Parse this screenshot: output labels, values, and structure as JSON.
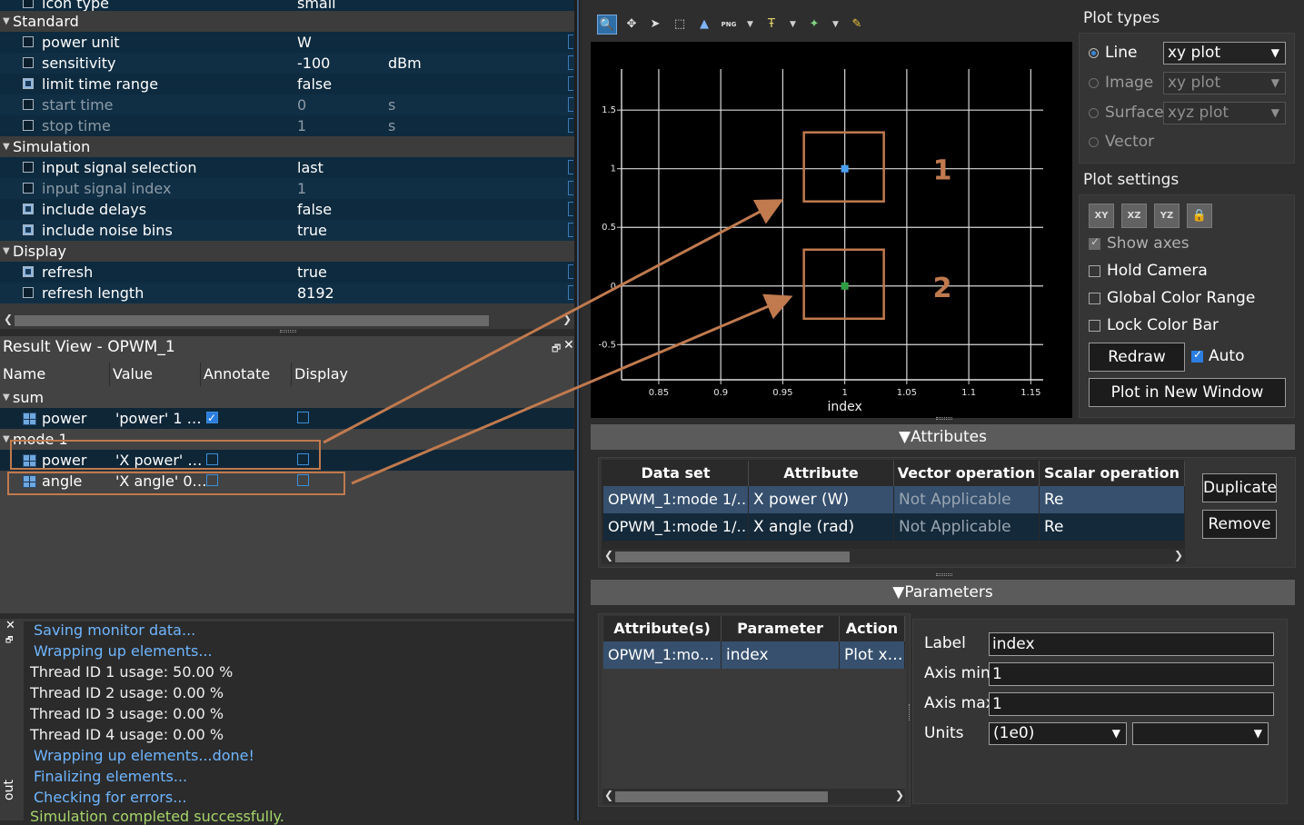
{
  "properties": {
    "rows": [
      {
        "type": "item",
        "label": "icon type",
        "value": "small",
        "unit": ""
      },
      {
        "type": "cat",
        "label": "Standard"
      },
      {
        "type": "item",
        "label": "power unit",
        "value": "W",
        "unit": ""
      },
      {
        "type": "item",
        "label": "sensitivity",
        "value": "-100",
        "unit": "dBm"
      },
      {
        "type": "item",
        "label": "limit time range",
        "value": "false",
        "unit": "",
        "checked": true
      },
      {
        "type": "item",
        "label": "start time",
        "value": "0",
        "unit": "s",
        "disabled": true
      },
      {
        "type": "item",
        "label": "stop time",
        "value": "1",
        "unit": "s",
        "disabled": true
      },
      {
        "type": "cat",
        "label": "Simulation"
      },
      {
        "type": "item",
        "label": "input signal selection",
        "value": "last",
        "unit": ""
      },
      {
        "type": "item",
        "label": "input signal index",
        "value": "1",
        "unit": "",
        "disabled": true
      },
      {
        "type": "item",
        "label": "include delays",
        "value": "false",
        "unit": "",
        "checked": true
      },
      {
        "type": "item",
        "label": "include noise bins",
        "value": "true",
        "unit": "",
        "checked": true
      },
      {
        "type": "cat",
        "label": "Display"
      },
      {
        "type": "item",
        "label": "refresh",
        "value": "true",
        "unit": "",
        "checked": true
      },
      {
        "type": "item",
        "label": "refresh length",
        "value": "8192",
        "unit": ""
      }
    ]
  },
  "result_view": {
    "title": "Result View - OPWM_1",
    "columns": [
      "Name",
      "Value",
      "Annotate",
      "Display"
    ],
    "groups": [
      {
        "name": "sum",
        "rows": [
          {
            "name": "power",
            "value": "'power' 1 …",
            "annotate": true,
            "display": false
          }
        ]
      },
      {
        "name": "mode 1",
        "rows": [
          {
            "name": "power",
            "value": "'X power' …",
            "annotate": false,
            "display": false
          },
          {
            "name": "angle",
            "value": "'X angle' 0…",
            "annotate": false,
            "display": false
          }
        ]
      }
    ]
  },
  "log": {
    "lines": [
      {
        "text": "Saving monitor data...",
        "style": "blue"
      },
      {
        "text": "Wrapping up elements...",
        "style": "blue"
      },
      {
        "text": "Thread ID 1 usage: 50.00 %",
        "style": "white"
      },
      {
        "text": "Thread ID 2 usage: 0.00 %",
        "style": "white"
      },
      {
        "text": "Thread ID 3 usage: 0.00 %",
        "style": "white"
      },
      {
        "text": "Thread ID 4 usage: 0.00 %",
        "style": "white"
      },
      {
        "text": "Wrapping up elements...done!",
        "style": "blue"
      },
      {
        "text": "Finalizing elements...",
        "style": "blue"
      },
      {
        "text": "Checking for errors...",
        "style": "blue"
      },
      {
        "text": "Simulation completed successfully.",
        "style": "green"
      }
    ],
    "side_label": "out"
  },
  "toolbar": {
    "icons": [
      "zoom-icon",
      "pan-icon",
      "select-icon",
      "zoom-box-icon",
      "mountain-icon",
      "png-export-icon",
      "text-icon",
      "marker-icon",
      "pencil-icon"
    ],
    "png_label": "PNG"
  },
  "chart_data": {
    "type": "scatter",
    "xlabel": "index",
    "ylabel": "",
    "xlim": [
      0.82,
      1.16
    ],
    "ylim": [
      -0.8,
      1.85
    ],
    "x_ticks": [
      "0.85",
      "0.9",
      "0.95",
      "1",
      "1.05",
      "1.1",
      "1.15"
    ],
    "y_ticks": [
      "-0.5",
      "0",
      "0.5",
      "1",
      "1.5"
    ],
    "grid": true,
    "series": [
      {
        "x": [
          1
        ],
        "y": [
          1
        ],
        "color": "#4a9ff5"
      },
      {
        "x": [
          1
        ],
        "y": [
          0
        ],
        "color": "#2ea043"
      }
    ],
    "annotations": [
      "1",
      "2"
    ]
  },
  "plot_types": {
    "title": "Plot types",
    "options": [
      {
        "label": "Line",
        "dropdown": "xy plot",
        "selected": true
      },
      {
        "label": "Image",
        "dropdown": "xy plot",
        "selected": false
      },
      {
        "label": "Surface",
        "dropdown": "xyz plot",
        "selected": false
      },
      {
        "label": "Vector",
        "dropdown": "",
        "selected": false
      }
    ]
  },
  "plot_settings": {
    "title": "Plot settings",
    "view_buttons": [
      "XY",
      "XZ",
      "YZ"
    ],
    "checkboxes": [
      {
        "label": "Show axes",
        "checked": true,
        "disabled": true
      },
      {
        "label": "Hold Camera",
        "checked": false
      },
      {
        "label": "Global Color Range",
        "checked": false
      },
      {
        "label": "Lock Color Bar",
        "checked": false
      }
    ],
    "redraw_label": "Redraw",
    "auto_label": "Auto",
    "auto_checked": true,
    "plot_new_window_label": "Plot in New Window"
  },
  "attributes": {
    "title": "Attributes",
    "columns": [
      "Data set",
      "Attribute",
      "Vector operation",
      "Scalar operation"
    ],
    "rows": [
      [
        "OPWM_1:mode 1/…",
        "X power (W)",
        "Not Applicable",
        "Re"
      ],
      [
        "OPWM_1:mode 1/…",
        "X angle (rad)",
        "Not Applicable",
        "Re"
      ]
    ],
    "duplicate_label": "Duplicate",
    "remove_label": "Remove"
  },
  "parameters": {
    "title": "Parameters",
    "columns": [
      "Attribute(s)",
      "Parameter",
      "Action"
    ],
    "rows": [
      [
        "OPWM_1:mo…",
        "index",
        "Plot x…"
      ]
    ],
    "label_label": "Label",
    "label_value": "index",
    "axis_min_label": "Axis min",
    "axis_min_value": "1",
    "axis_max_label": "Axis max",
    "axis_max_value": "1",
    "units_label": "Units",
    "units_value": "(1e0)",
    "units_value2": ""
  },
  "colors": {
    "accent": "#2b7de0",
    "annotation": "#c07a4e",
    "selection": "#36506e"
  }
}
